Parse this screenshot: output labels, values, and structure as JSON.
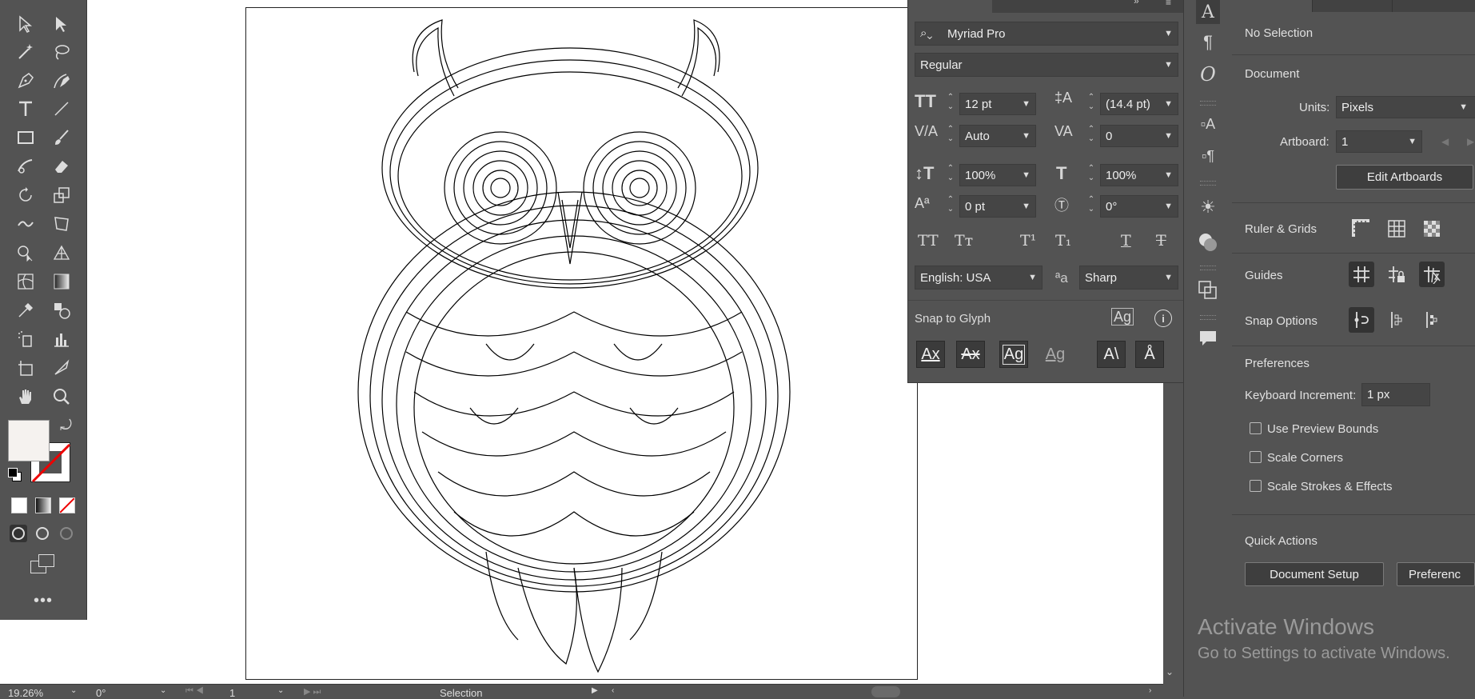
{
  "status_bar": {
    "zoom": "19.26%",
    "rotation": "0°",
    "artboard_num": "1",
    "tool_name": "Selection"
  },
  "character_panel": {
    "font_family": "Myriad Pro",
    "font_style": "Regular",
    "font_size": "12 pt",
    "leading": "(14.4 pt)",
    "kerning": "Auto",
    "tracking": "0",
    "vertical_scale": "100%",
    "horizontal_scale": "100%",
    "baseline_shift": "0 pt",
    "rotation": "0°",
    "language": "English: USA",
    "antialias": "Sharp",
    "snap_to_glyph_label": "Snap to Glyph",
    "aa_label": "ªa"
  },
  "properties": {
    "selection": "No Selection",
    "document_heading": "Document",
    "units_label": "Units:",
    "units_value": "Pixels",
    "artboard_label": "Artboard:",
    "artboard_value": "1",
    "edit_artboards": "Edit Artboards",
    "ruler_grids": "Ruler & Grids",
    "guides": "Guides",
    "snap_options": "Snap Options",
    "preferences_heading": "Preferences",
    "keyboard_increment_label": "Keyboard Increment:",
    "keyboard_increment_value": "1 px",
    "use_preview_bounds": "Use Preview Bounds",
    "scale_corners": "Scale Corners",
    "scale_strokes": "Scale Strokes & Effects",
    "quick_actions": "Quick Actions",
    "document_setup": "Document Setup",
    "preferences_btn": "Preferenc"
  },
  "watermark": {
    "line1": "Activate Windows",
    "line2": "Go to Settings to activate Windows."
  },
  "colors": {
    "ui_bg": "#535353",
    "fill_swatch": "#f5f2ef"
  }
}
